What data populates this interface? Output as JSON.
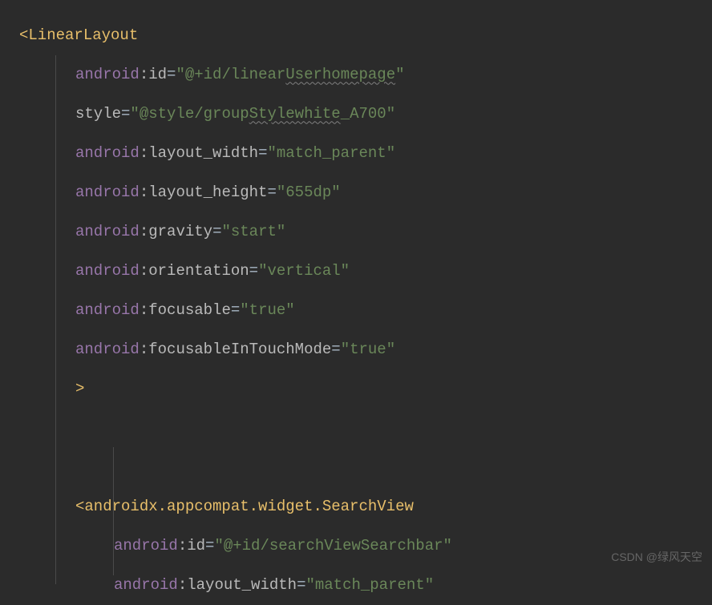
{
  "code": {
    "element1": {
      "openTag": "<",
      "tagName": "LinearLayout",
      "attrs": [
        {
          "ns": "android",
          "sep": ":",
          "name": "id",
          "eq": "=",
          "value": "\"@+id/linear",
          "valueWavy": "Userhomepage",
          "valueEnd": "\""
        },
        {
          "ns": "",
          "sep": "",
          "name": "style",
          "eq": "=",
          "value": "\"@style/group",
          "valueWavy": "Stylewhite",
          "valueEnd": "_A700\""
        },
        {
          "ns": "android",
          "sep": ":",
          "name": "layout_width",
          "eq": "=",
          "value": "\"match_parent\"",
          "valueWavy": "",
          "valueEnd": ""
        },
        {
          "ns": "android",
          "sep": ":",
          "name": "layout_height",
          "eq": "=",
          "value": "\"655dp\"",
          "valueWavy": "",
          "valueEnd": ""
        },
        {
          "ns": "android",
          "sep": ":",
          "name": "gravity",
          "eq": "=",
          "value": "\"start\"",
          "valueWavy": "",
          "valueEnd": ""
        },
        {
          "ns": "android",
          "sep": ":",
          "name": "orientation",
          "eq": "=",
          "value": "\"vertical\"",
          "valueWavy": "",
          "valueEnd": ""
        },
        {
          "ns": "android",
          "sep": ":",
          "name": "focusable",
          "eq": "=",
          "value": "\"true\"",
          "valueWavy": "",
          "valueEnd": ""
        },
        {
          "ns": "android",
          "sep": ":",
          "name": "focusableInTouchMode",
          "eq": "=",
          "value": "\"true\"",
          "valueWavy": "",
          "valueEnd": ""
        }
      ],
      "closeBracket": ">"
    },
    "element2": {
      "openTag": "<",
      "tagName": "androidx.appcompat.widget.SearchView",
      "attrs": [
        {
          "ns": "android",
          "sep": ":",
          "name": "id",
          "eq": "=",
          "value": "\"@+id/searchViewSearchbar\"",
          "valueWavy": "",
          "valueEnd": ""
        },
        {
          "ns": "android",
          "sep": ":",
          "name": "layout_width",
          "eq": "=",
          "value": "\"match_parent\"",
          "valueWavy": "",
          "valueEnd": ""
        }
      ]
    }
  },
  "watermark": "CSDN @绿风天空"
}
